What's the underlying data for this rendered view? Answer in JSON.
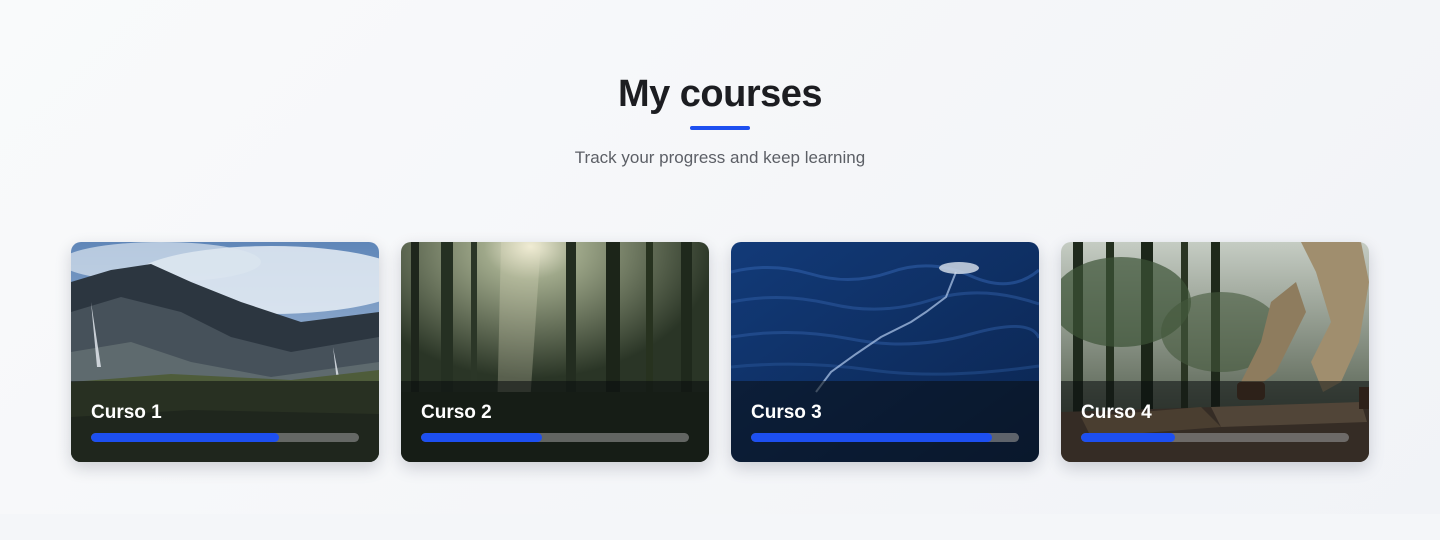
{
  "header": {
    "title": "My courses",
    "subtitle": "Track your progress and keep learning",
    "accent_color": "#1d4ff0"
  },
  "courses": [
    {
      "title": "Curso 1",
      "progress": 0.7,
      "image": "mountain-landscape"
    },
    {
      "title": "Curso 2",
      "progress": 0.45,
      "image": "forest-sunlight"
    },
    {
      "title": "Curso 3",
      "progress": 0.9,
      "image": "ocean-water"
    },
    {
      "title": "Curso 4",
      "progress": 0.35,
      "image": "hiker-walking-forest"
    }
  ]
}
